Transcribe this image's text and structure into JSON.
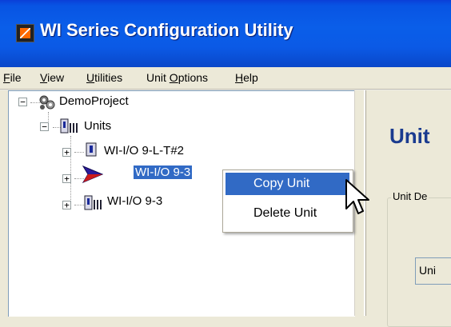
{
  "window": {
    "title": "WI Series Configuration Utility"
  },
  "menu": {
    "items": [
      {
        "mnemonic": "F",
        "rest": "ile"
      },
      {
        "mnemonic": "V",
        "rest": "iew"
      },
      {
        "mnemonic": "U",
        "rest": "tilities"
      },
      {
        "pre": "Unit ",
        "mnemonic": "O",
        "rest": "ptions"
      },
      {
        "mnemonic": "H",
        "rest": "elp"
      }
    ]
  },
  "tree": {
    "project": {
      "label": "DemoProject",
      "expander": "−",
      "icon": "project-gears-icon"
    },
    "units": {
      "label": "Units",
      "expander": "−",
      "icon": "units-folder-icon"
    },
    "unit_items": [
      {
        "label": "WI-I/O 9-L-T#2",
        "expander": "+",
        "icon": "unit-device-icon",
        "selected": false
      },
      {
        "label": "WI-I/O 9-3",
        "expander": "+",
        "icon": "arrow-pointer-icon",
        "selected": true
      },
      {
        "label": "WI-I/O 9-3",
        "expander": "+",
        "icon": "units-folder-icon",
        "selected": false
      }
    ]
  },
  "context_menu": {
    "items": [
      {
        "label": "Copy Unit",
        "highlighted": true
      },
      {
        "label": "Delete Unit",
        "highlighted": false
      }
    ]
  },
  "right_panel": {
    "title": "Unit",
    "group_label": "Unit De",
    "field_text": "Uni"
  },
  "colors": {
    "titlebar": "#0a5ee9",
    "selection": "#316ac5",
    "heading": "#1a3b8f",
    "window_bg": "#ece9d8"
  }
}
